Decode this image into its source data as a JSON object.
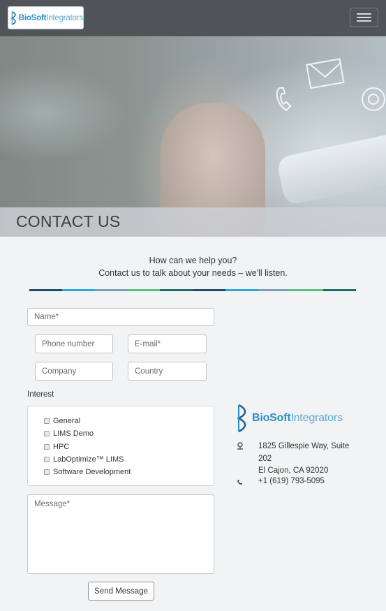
{
  "navbar": {
    "logo_bold": "BioSoft",
    "logo_light": "Integrators",
    "menu_icon": "hamburger-icon"
  },
  "hero": {
    "title": "CONTACT US",
    "icons": [
      "envelope-icon",
      "at-icon",
      "phone-handset-icon"
    ]
  },
  "intro": {
    "line1": "How can we help you?",
    "line2": "Contact us to talk about your needs – we'll listen."
  },
  "divider_colors": [
    "#1f4e6b",
    "#2ea8d8",
    "#7d9fb4",
    "#5cbf7f",
    "#1f6e6b",
    "#1f4e6b",
    "#2ea8d8",
    "#7d9fb4",
    "#5cbf7f",
    "#1f6e6b"
  ],
  "form": {
    "name_placeholder": "Name*",
    "phone_placeholder": "Phone number",
    "email_placeholder": "E-mail*",
    "company_placeholder": "Company",
    "country_placeholder": "Country",
    "interest_label": "Interest",
    "interest_options": [
      "General",
      "LIMS Demo",
      "HPC",
      "LabOptimize™ LIMS",
      "Software Development"
    ],
    "message_placeholder": "Message*",
    "send_label": "Send Message"
  },
  "contact_info": {
    "logo_bold": "BioSoft",
    "logo_light": "Integrators",
    "address_line1": "1825 Gillespie Way, Suite 202",
    "address_line2": "El Cajon, CA 92020",
    "phone": "+1 (619) 793-5095",
    "address_icon": "map-marker-icon",
    "phone_icon": "phone-icon"
  }
}
